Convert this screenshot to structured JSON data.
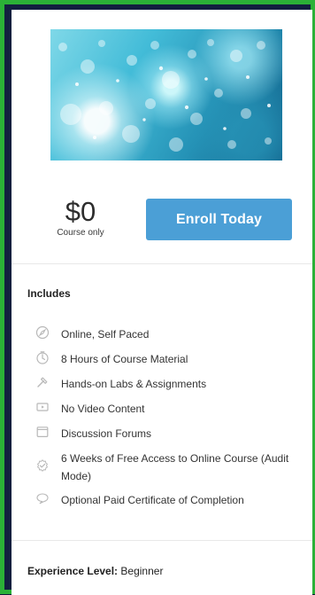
{
  "course_card": {
    "price": "$0",
    "price_note": "Course only",
    "enroll_label": "Enroll Today",
    "includes_title": "Includes",
    "features": [
      {
        "label": "Online, Self Paced",
        "icon": "compass-icon"
      },
      {
        "label": "8 Hours of Course Material",
        "icon": "clock-icon"
      },
      {
        "label": "Hands-on Labs & Assignments",
        "icon": "hammer-icon"
      },
      {
        "label": "No Video Content",
        "icon": "video-icon"
      },
      {
        "label": "Discussion Forums",
        "icon": "calendar-icon"
      },
      {
        "label": "6 Weeks of Free Access to Online Course (Audit Mode)",
        "icon": "badge-check-icon"
      },
      {
        "label": "Optional Paid Certificate of Completion",
        "icon": "speech-bubble-icon"
      }
    ],
    "experience_label": "Experience Level:",
    "experience_value": "Beginner"
  },
  "colors": {
    "frame": "#2bb137",
    "background": "#12203f",
    "card": "#ffffff",
    "button": "#4b9fd6",
    "icon": "#b8b8b8",
    "divider": "#e8e8e8"
  }
}
